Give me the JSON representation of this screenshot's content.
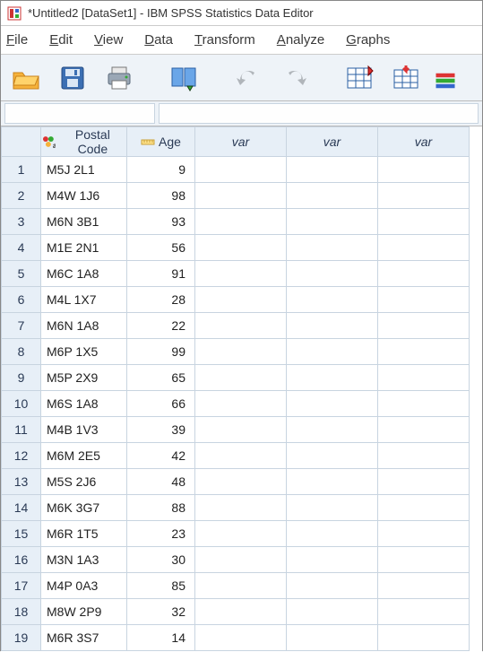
{
  "window": {
    "title": "*Untitled2 [DataSet1] - IBM SPSS Statistics Data Editor"
  },
  "menu": {
    "file": "File",
    "edit": "Edit",
    "view": "View",
    "data": "Data",
    "transform": "Transform",
    "analyze": "Analyze",
    "graphs": "Graphs"
  },
  "columns": {
    "postal": "Postal Code",
    "age": "Age",
    "var": "var"
  },
  "rows": [
    {
      "n": "1",
      "postal": "M5J 2L1",
      "age": "9"
    },
    {
      "n": "2",
      "postal": "M4W 1J6",
      "age": "98"
    },
    {
      "n": "3",
      "postal": "M6N 3B1",
      "age": "93"
    },
    {
      "n": "4",
      "postal": "M1E 2N1",
      "age": "56"
    },
    {
      "n": "5",
      "postal": "M6C 1A8",
      "age": "91"
    },
    {
      "n": "6",
      "postal": "M4L 1X7",
      "age": "28"
    },
    {
      "n": "7",
      "postal": "M6N 1A8",
      "age": "22"
    },
    {
      "n": "8",
      "postal": "M6P 1X5",
      "age": "99"
    },
    {
      "n": "9",
      "postal": "M5P 2X9",
      "age": "65"
    },
    {
      "n": "10",
      "postal": "M6S 1A8",
      "age": "66"
    },
    {
      "n": "11",
      "postal": "M4B 1V3",
      "age": "39"
    },
    {
      "n": "12",
      "postal": "M6M 2E5",
      "age": "42"
    },
    {
      "n": "13",
      "postal": "M5S 2J6",
      "age": "48"
    },
    {
      "n": "14",
      "postal": "M6K 3G7",
      "age": "88"
    },
    {
      "n": "15",
      "postal": "M6R 1T5",
      "age": "23"
    },
    {
      "n": "16",
      "postal": "M3N 1A3",
      "age": "30"
    },
    {
      "n": "17",
      "postal": "M4P 0A3",
      "age": "85"
    },
    {
      "n": "18",
      "postal": "M8W 2P9",
      "age": "32"
    },
    {
      "n": "19",
      "postal": "M6R 3S7",
      "age": "14"
    }
  ],
  "icons": {
    "app": "app-icon",
    "open": "open-folder-icon",
    "save": "save-disk-icon",
    "print": "printer-icon",
    "recall": "recall-dialog-icon",
    "undo": "undo-icon",
    "redo": "redo-icon",
    "goto": "goto-case-icon",
    "gotov": "goto-variable-icon",
    "vars": "variables-icon"
  },
  "colors": {
    "header_bg": "#e7eff7",
    "grid_line": "#c8d4e0",
    "toolbar_bg": "#eef3f8",
    "menu_text": "#3a3a3a"
  }
}
